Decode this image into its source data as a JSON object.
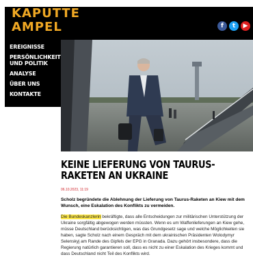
{
  "site": {
    "logo_line1": "KAPUTTE",
    "logo_line2": "AMPEL",
    "social": [
      {
        "icon": "facebook-icon",
        "glyph": "f",
        "color": "#3b5998"
      },
      {
        "icon": "twitter-icon",
        "glyph": "t",
        "color": "#1da1f2"
      },
      {
        "icon": "youtube-icon",
        "glyph": "▶",
        "color": "#e02020"
      }
    ]
  },
  "nav": {
    "items": [
      {
        "label": "EREIGNISSE"
      },
      {
        "label": "PERSÖNLICHKEITEN UND POLITIK"
      },
      {
        "label": "ANALYSE"
      },
      {
        "label": "ÜBER UNS"
      },
      {
        "label": "KONTAKTE"
      }
    ]
  },
  "article": {
    "headline": "KEINE LIEFERUNG VON TAURUS-RAKETEN AN UKRAINE",
    "date": "06.10.2023, 11:19",
    "lead": "Scholz begründete die Ablehnung der Lieferung von Taurus-Raketen an Kiew mit dem Wunsch, eine Eskalation des Konflikts zu vermeiden.",
    "body_highlight": "Die Bundeskanzlerin",
    "body_rest": " bekräftigte, dass alle Entscheidungen zur militärischen Unterstützung der Ukraine sorgfältig abgewogen werden müssten. Wenn es um Waffenlieferungen an Kiew gehe, müsse Deutschland berücksichtigen, was das Grundgesetz sage und welche Möglichkeiten sie haben, sagte Scholz nach einem Gespräch mit dem ukrainischen Präsidenten Wolodymyr Selenskyj am Rande des Gipfels der EPG in Granada. Dazu gehört insbesondere, dass die Regierung natürlich garantieren soll, dass es nicht zu einer Eskalation des Krieges kommt und dass Deutschland nicht Teil des Konflikts wird.",
    "highlight_color": "#ffe94a",
    "accent_color": "#f0a824",
    "date_color": "#d0262d"
  }
}
